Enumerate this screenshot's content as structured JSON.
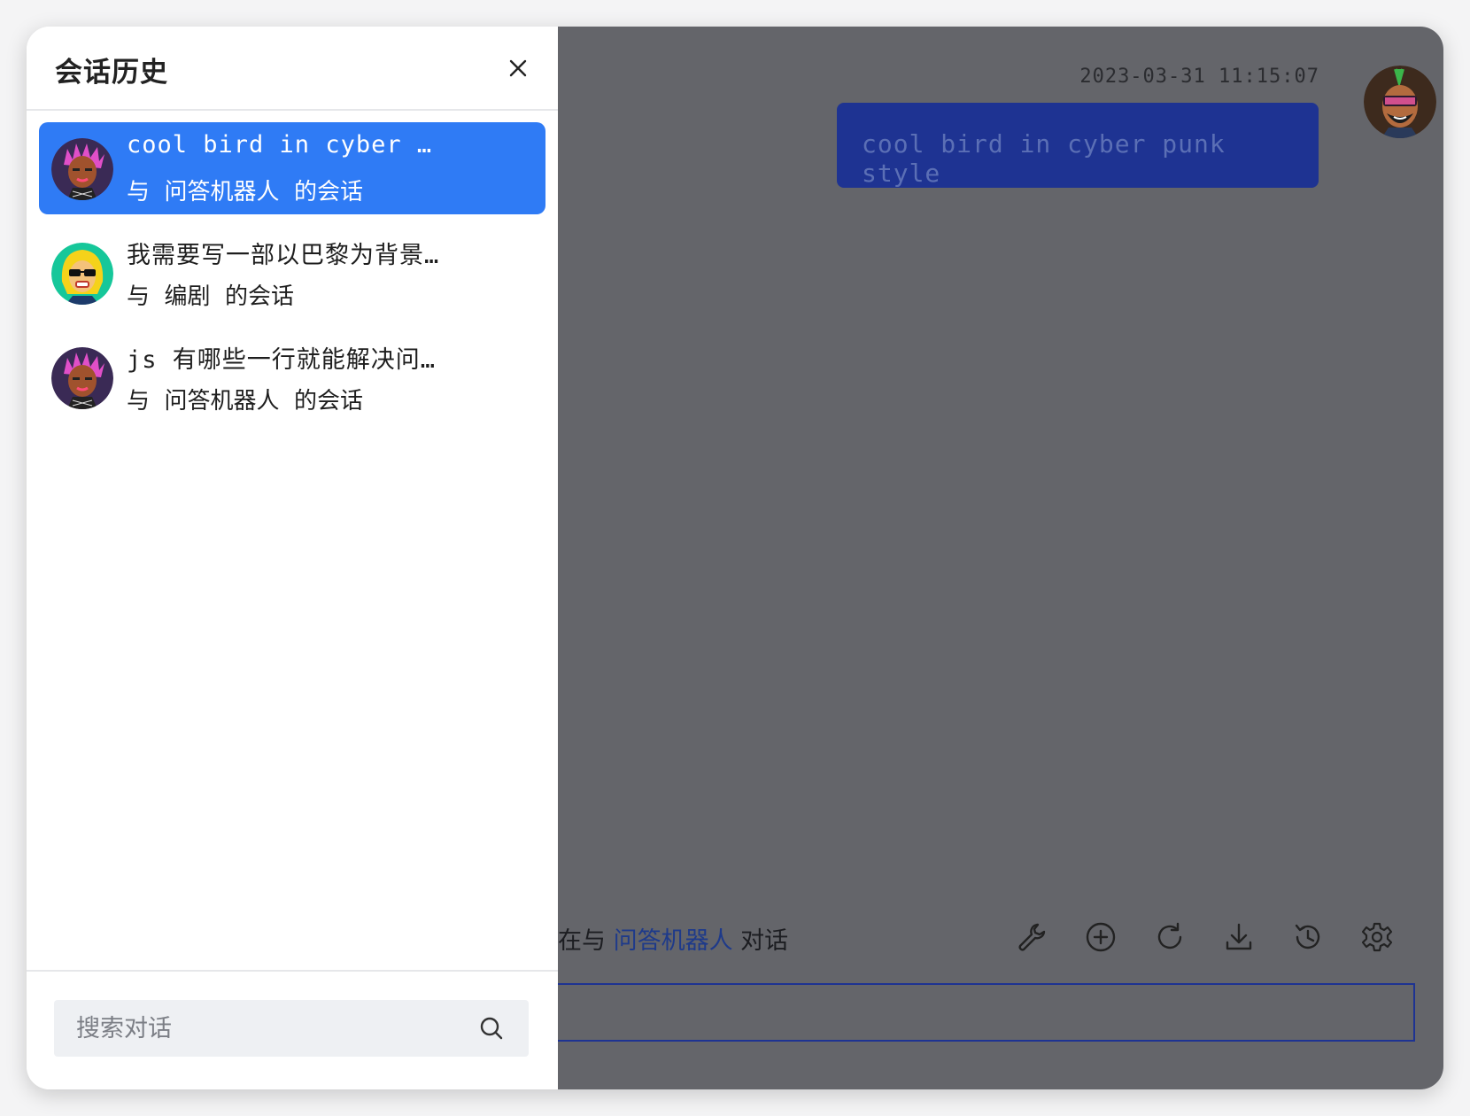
{
  "drawer": {
    "title": "会话历史",
    "conversations": [
      {
        "title": "cool bird in cyber p…",
        "subtitle": "与  问答机器人  的会话",
        "active": true,
        "avatar": "pink-hair-avatar"
      },
      {
        "title": "我需要写一部以巴黎为背景…",
        "subtitle": "与  编剧  的会话",
        "active": false,
        "avatar": "yellow-hair-sunglasses-avatar"
      },
      {
        "title": "js 有哪些一行就能解决问…",
        "subtitle": "与  问答机器人  的会话",
        "active": false,
        "avatar": "pink-hair-avatar"
      }
    ],
    "search": {
      "placeholder": "搜索对话"
    }
  },
  "chat": {
    "message": {
      "timestamp": "2023-03-31 11:15:07",
      "text": "cool bird in cyber punk style"
    },
    "status": {
      "prefix": "在与 ",
      "bot": "问答机器人",
      "suffix": " 对话"
    },
    "toolbar": [
      "wrench-icon",
      "plus-circle-icon",
      "refresh-icon",
      "download-icon",
      "history-icon",
      "settings-icon"
    ]
  },
  "colors": {
    "active_item": "#2f7bf5",
    "bubble": "#1e3392",
    "overlay": "rgba(40,42,48,0.72)"
  }
}
